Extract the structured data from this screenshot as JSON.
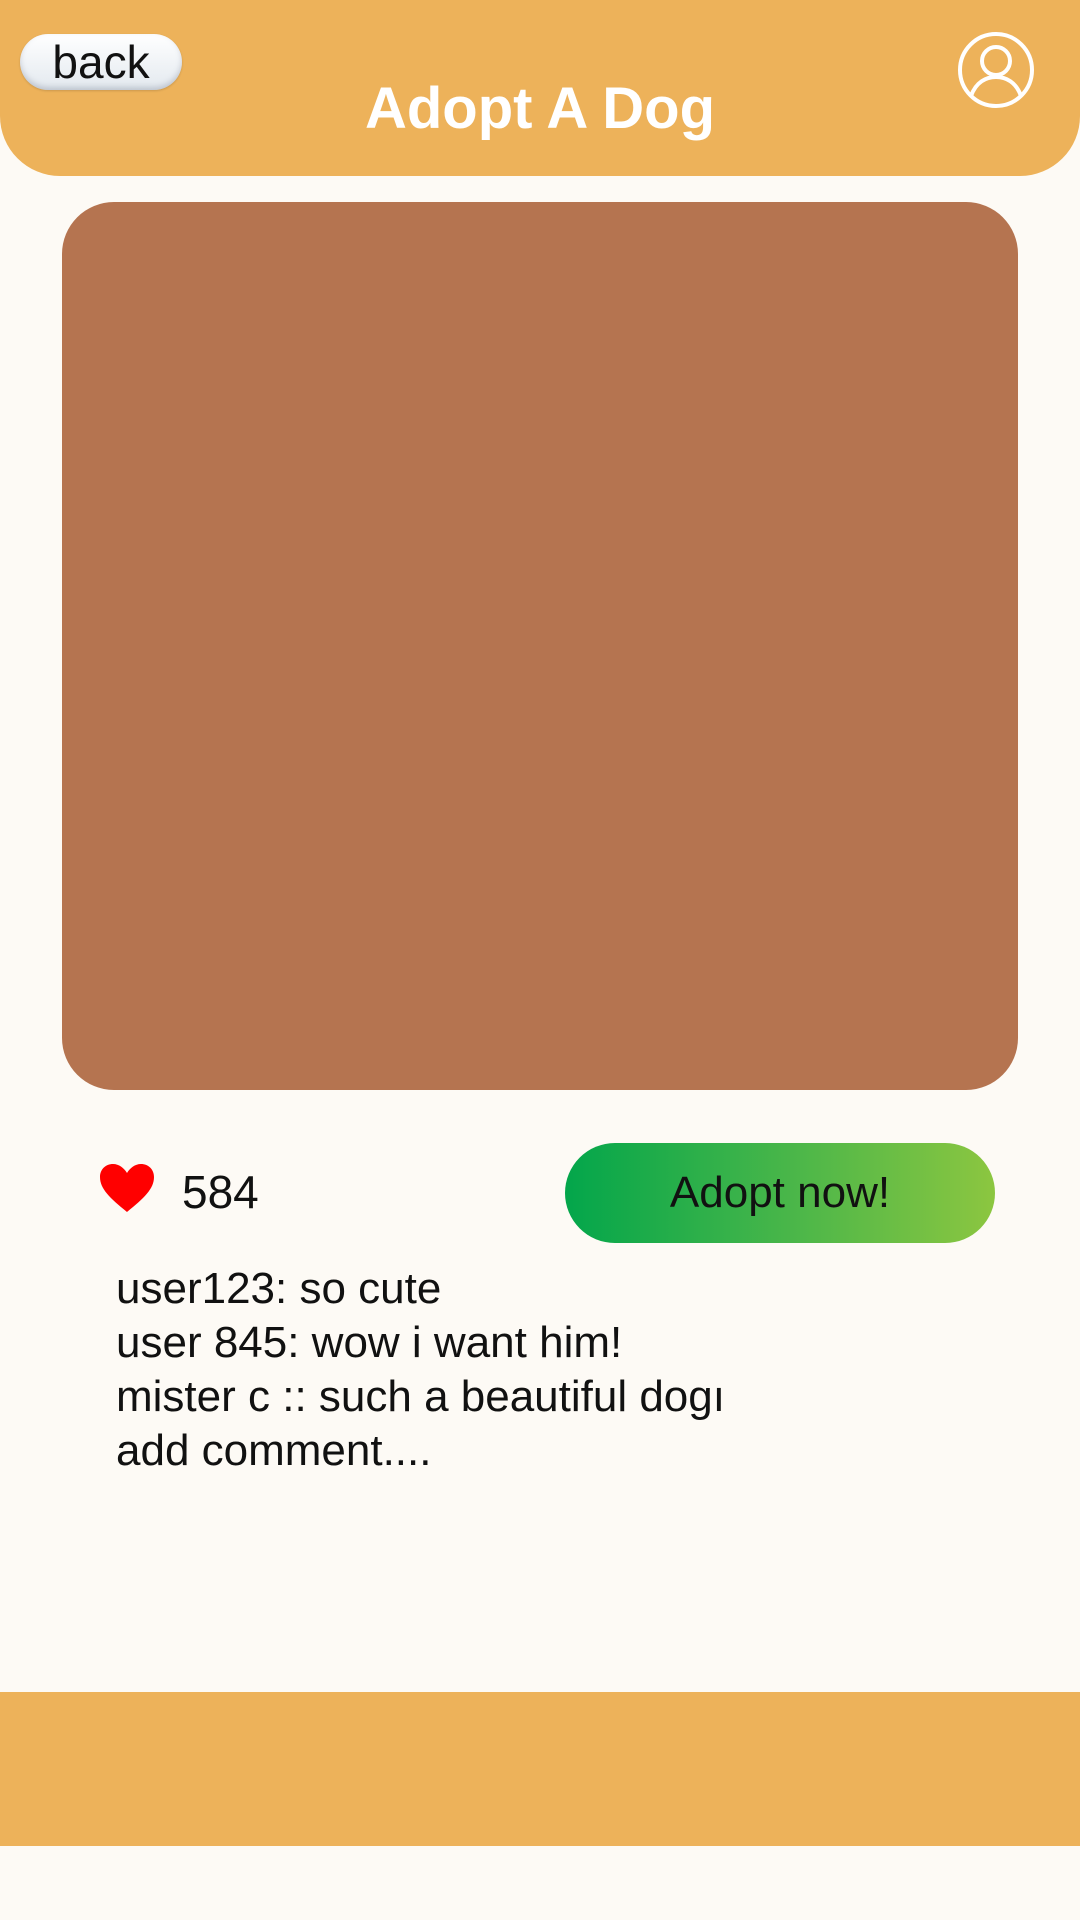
{
  "header": {
    "back_label": "back",
    "title": "Adopt A Dog",
    "profile_icon": "user-circle-icon"
  },
  "post": {
    "likes_icon": "heart-icon",
    "likes_count": "584",
    "adopt_label": "Adopt now!",
    "comments": [
      "user123: so cute",
      "user 845: wow i want him!",
      "mister c :: such a beautiful dogı"
    ],
    "add_comment_label": "add comment...."
  },
  "colors": {
    "header_bg": "#edb25a",
    "page_bg": "#fdfaf5",
    "photo_placeholder": "#b57450",
    "heart": "#ff0000",
    "adopt_gradient_start": "#03a64b",
    "adopt_gradient_end": "#8cc640"
  }
}
